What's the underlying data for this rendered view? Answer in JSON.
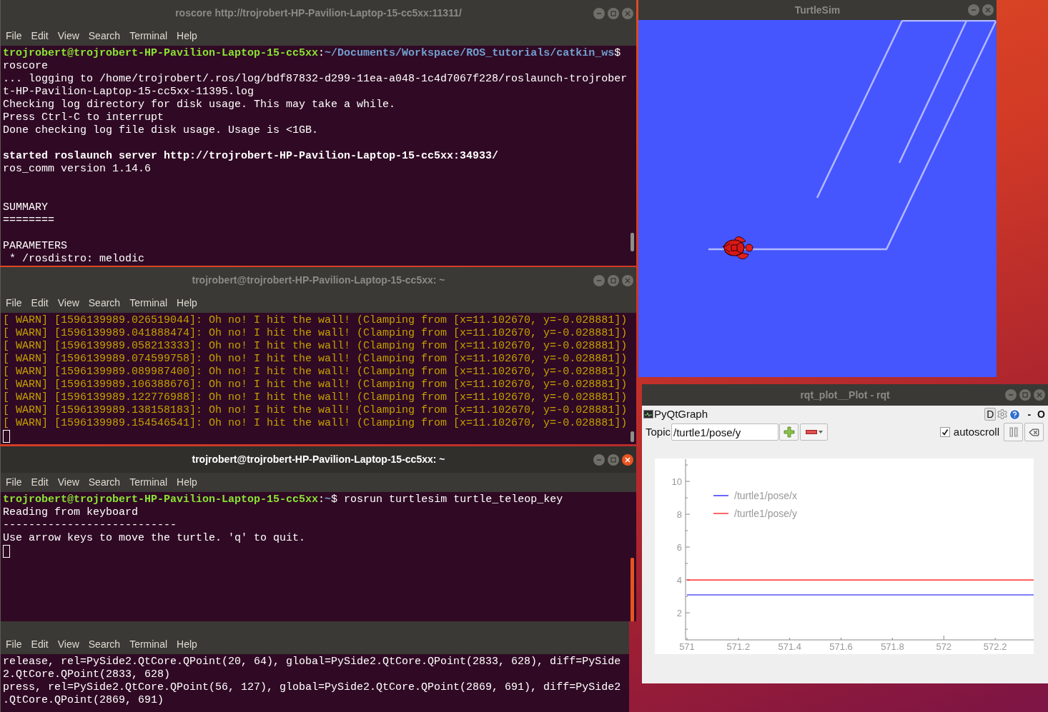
{
  "terminals": [
    {
      "title": "roscore http://trojrobert-HP-Pavilion-Laptop-15-cc5xx:11311/",
      "active": false,
      "menu": [
        "File",
        "Edit",
        "View",
        "Search",
        "Terminal",
        "Help"
      ],
      "lines": [
        {
          "kind": "prompt",
          "segments": [
            {
              "kind": "user",
              "text": "trojrobert@trojrobert-HP-Pavilion-Laptop-15-cc5xx"
            },
            {
              "kind": "plain",
              "text": ":"
            },
            {
              "kind": "path",
              "text": "~/Documents/Workspace/ROS_tutorials/catkin_ws"
            },
            {
              "kind": "plain",
              "text": "$"
            }
          ]
        },
        {
          "kind": "text",
          "text": "roscore"
        },
        {
          "kind": "text",
          "text": "... logging to /home/trojrobert/.ros/log/bdf87832-d299-11ea-a048-1c4d7067f228/roslaunch-trojrober"
        },
        {
          "kind": "text",
          "text": "t-HP-Pavilion-Laptop-15-cc5xx-11395.log"
        },
        {
          "kind": "text",
          "text": "Checking log directory for disk usage. This may take a while."
        },
        {
          "kind": "text",
          "text": "Press Ctrl-C to interrupt"
        },
        {
          "kind": "text",
          "text": "Done checking log file disk usage. Usage is <1GB."
        },
        {
          "kind": "blank"
        },
        {
          "kind": "bold",
          "text": "started roslaunch server http://trojrobert-HP-Pavilion-Laptop-15-cc5xx:34933/"
        },
        {
          "kind": "text",
          "text": "ros_comm version 1.14.6"
        },
        {
          "kind": "blank"
        },
        {
          "kind": "blank"
        },
        {
          "kind": "text",
          "text": "SUMMARY"
        },
        {
          "kind": "text",
          "text": "========"
        },
        {
          "kind": "blank"
        },
        {
          "kind": "text",
          "text": "PARAMETERS"
        },
        {
          "kind": "text",
          "text": " * /rosdistro: melodic"
        }
      ]
    },
    {
      "title": "trojrobert@trojrobert-HP-Pavilion-Laptop-15-cc5xx: ~",
      "active": false,
      "menu": [
        "File",
        "Edit",
        "View",
        "Search",
        "Terminal",
        "Help"
      ],
      "lines": [
        {
          "kind": "warn",
          "text": "[ WARN] [1596139989.026519044]: Oh no! I hit the wall! (Clamping from [x=11.102670, y=-0.028881])"
        },
        {
          "kind": "warn",
          "text": "[ WARN] [1596139989.041888474]: Oh no! I hit the wall! (Clamping from [x=11.102670, y=-0.028881])"
        },
        {
          "kind": "warn",
          "text": "[ WARN] [1596139989.058213333]: Oh no! I hit the wall! (Clamping from [x=11.102670, y=-0.028881])"
        },
        {
          "kind": "warn",
          "text": "[ WARN] [1596139989.074599758]: Oh no! I hit the wall! (Clamping from [x=11.102670, y=-0.028881])"
        },
        {
          "kind": "warn",
          "text": "[ WARN] [1596139989.089987400]: Oh no! I hit the wall! (Clamping from [x=11.102670, y=-0.028881])"
        },
        {
          "kind": "warn",
          "text": "[ WARN] [1596139989.106388676]: Oh no! I hit the wall! (Clamping from [x=11.102670, y=-0.028881])"
        },
        {
          "kind": "warn",
          "text": "[ WARN] [1596139989.122776988]: Oh no! I hit the wall! (Clamping from [x=11.102670, y=-0.028881])"
        },
        {
          "kind": "warn",
          "text": "[ WARN] [1596139989.138158183]: Oh no! I hit the wall! (Clamping from [x=11.102670, y=-0.028881])"
        },
        {
          "kind": "warn",
          "text": "[ WARN] [1596139989.154546541]: Oh no! I hit the wall! (Clamping from [x=11.102670, y=-0.028881])"
        },
        {
          "kind": "cursor"
        }
      ]
    },
    {
      "title": "trojrobert@trojrobert-HP-Pavilion-Laptop-15-cc5xx: ~",
      "active": true,
      "menu": [
        "File",
        "Edit",
        "View",
        "Search",
        "Terminal",
        "Help"
      ],
      "lines": [
        {
          "kind": "prompt",
          "segments": [
            {
              "kind": "user",
              "text": "trojrobert@trojrobert-HP-Pavilion-Laptop-15-cc5xx"
            },
            {
              "kind": "plain",
              "text": ":"
            },
            {
              "kind": "path",
              "text": "~"
            },
            {
              "kind": "plain",
              "text": "$ rosrun turtlesim turtle_teleop_key"
            }
          ]
        },
        {
          "kind": "text",
          "text": "Reading from keyboard"
        },
        {
          "kind": "text",
          "text": "---------------------------"
        },
        {
          "kind": "text",
          "text": "Use arrow keys to move the turtle. 'q' to quit."
        },
        {
          "kind": "cursor"
        }
      ]
    },
    {
      "menu": [
        "File",
        "Edit",
        "View",
        "Search",
        "Terminal",
        "Help"
      ],
      "lines": [
        {
          "kind": "text",
          "text": "release, rel=PySide2.QtCore.QPoint(20, 64), global=PySide2.QtCore.QPoint(2833, 628), diff=PySide"
        },
        {
          "kind": "text",
          "text": "2.QtCore.QPoint(2833, 628)"
        },
        {
          "kind": "text",
          "text": "press, rel=PySide2.QtCore.QPoint(56, 127), global=PySide2.QtCore.QPoint(2869, 691), diff=PySide2"
        },
        {
          "kind": "text",
          "text": ".QtCore.QPoint(2869, 691)"
        }
      ]
    }
  ],
  "turtlesim": {
    "title": "TurtleSim",
    "active": false
  },
  "rqt": {
    "title": "rqt_plot__Plot - rqt",
    "active": false,
    "plugin": "PyQtGraph",
    "header_buttons": [
      "D"
    ],
    "dock_buttons": [
      "-",
      "O"
    ],
    "topic_label": "Topic",
    "topic_value": "/turtle1/pose/y",
    "autoscroll": {
      "label": "autoscroll",
      "checked": true
    },
    "plot": {
      "chart_data": {
        "type": "line",
        "x": [
          571,
          572.35
        ],
        "legend": "upper left",
        "series": [
          {
            "name": "/turtle1/pose/x",
            "color": "#0000ff",
            "values": [
              3.09,
              3.09
            ]
          },
          {
            "name": "/turtle1/pose/y",
            "color": "#ff0000",
            "values": [
              4,
              4
            ]
          }
        ],
        "xlim": [
          571,
          572.35
        ],
        "ylim": [
          0.35,
          11.35
        ],
        "xticks": [
          571,
          571.2,
          571.4,
          571.6,
          571.8,
          572,
          572.2
        ],
        "yticks": [
          2,
          4,
          6,
          8,
          10
        ]
      }
    }
  }
}
